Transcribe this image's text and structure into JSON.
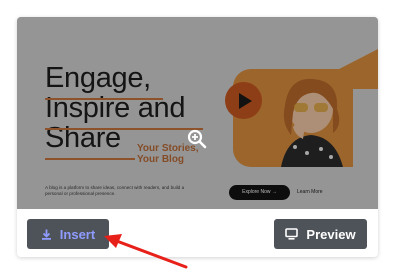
{
  "thumbnail": {
    "heading_lines": [
      "Engage,",
      "Inspire and",
      "Share"
    ],
    "subheading_lines": [
      "Your Stories,",
      "Your Blog"
    ],
    "description": "A blog is a platform to share ideas, connect with readers, and build a personal or professional presence.",
    "explore_label": "Explore Now →",
    "learn_label": "Learn More",
    "colors": {
      "accent": "#d88c3d",
      "play": "#c4571f",
      "text": "#1d1d1d"
    }
  },
  "actions": {
    "insert_label": "Insert",
    "preview_label": "Preview"
  },
  "icons": {
    "insert": "download-icon",
    "preview": "monitor-icon",
    "zoom": "zoom-in-icon"
  },
  "colors": {
    "button_bg": "#4e5359",
    "insert_text": "#8f9bff",
    "arrow": "#e8201a"
  }
}
